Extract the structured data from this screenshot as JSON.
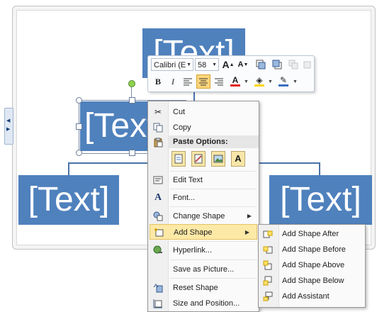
{
  "diagram": {
    "placeholder": "[Text]"
  },
  "mini_toolbar": {
    "font_name": "Calibri (E",
    "font_size": "58",
    "grow_font": "A",
    "shrink_font": "A",
    "bold": "B",
    "italic": "I",
    "font_color_letter": "A",
    "font_color": "#e0241b",
    "highlight_color": "#ffd400"
  },
  "context_menu": {
    "cut": "Cut",
    "copy": "Copy",
    "paste_options": "Paste Options:",
    "paste_text_glyph": "A",
    "edit_text": "Edit Text",
    "font": "Font...",
    "change_shape": "Change Shape",
    "add_shape": "Add Shape",
    "hyperlink": "Hyperlink...",
    "save_as_picture": "Save as Picture...",
    "reset_shape": "Reset Shape",
    "size_and_position": "Size and Position..."
  },
  "submenu": {
    "add_shape_after": "Add Shape After",
    "add_shape_before": "Add Shape Before",
    "add_shape_above": "Add Shape Above",
    "add_shape_below": "Add Shape Below",
    "add_assistant": "Add Assistant"
  },
  "colors": {
    "shape_fill": "#4f81bd",
    "menu_highlight": "#fde9a6"
  }
}
